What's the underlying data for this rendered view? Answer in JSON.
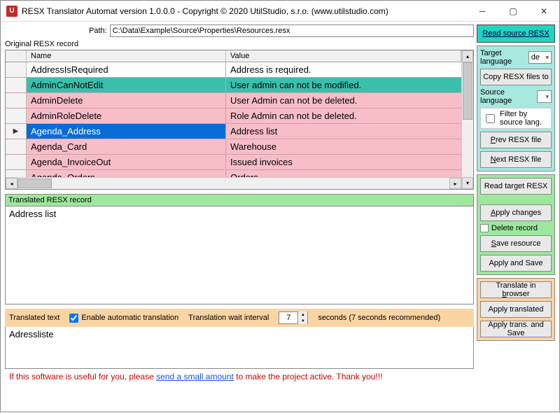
{
  "window": {
    "title": "RESX Translator Automat version 1.0.0.0 - Copyright © 2020 UtilStudio, s.r.o. (www.utilstudio.com)",
    "icon_letter": "U"
  },
  "path": {
    "label": "Path:",
    "value": "C:\\Data\\Example\\Source\\Properties\\Resources.resx"
  },
  "original": {
    "label": "Original RESX record",
    "col_name": "Name",
    "col_value": "Value",
    "rows": [
      {
        "name": "AddressIsRequired",
        "value": "Address is required.",
        "style": "white",
        "selected": false,
        "indicator": ""
      },
      {
        "name": "AdminCanNotEdit",
        "value": "User admin can not be modified.",
        "style": "teal",
        "selected": false,
        "indicator": ""
      },
      {
        "name": "AdminDelete",
        "value": "User Admin can not be deleted.",
        "style": "pink",
        "selected": false,
        "indicator": ""
      },
      {
        "name": "AdminRoleDelete",
        "value": "Role Admin can not be deleted.",
        "style": "pink",
        "selected": false,
        "indicator": ""
      },
      {
        "name": "Agenda_Address",
        "value": "Address list",
        "style": "pink",
        "selected": true,
        "indicator": "▶"
      },
      {
        "name": "Agenda_Card",
        "value": "Warehouse",
        "style": "pink",
        "selected": false,
        "indicator": ""
      },
      {
        "name": "Agenda_InvoiceOut",
        "value": "Issued invoices",
        "style": "pink",
        "selected": false,
        "indicator": ""
      },
      {
        "name": "Agenda_Orders",
        "value": "Orders",
        "style": "pink",
        "selected": false,
        "indicator": ""
      }
    ]
  },
  "translated_record": {
    "label": "Translated RESX record",
    "value": "Address list"
  },
  "translate_bar": {
    "label_left": "Translated text",
    "enable_label": "Enable automatic translation",
    "enable_checked": true,
    "interval_label": "Translation wait interval",
    "interval_value": "7",
    "interval_hint": "seconds (7 seconds recommended)"
  },
  "translated_text": {
    "value": "Adressliste"
  },
  "footer": {
    "prefix": "If this software is useful for you, please ",
    "link": "send a small amount",
    "suffix": " to make the project active. Thank you!!!"
  },
  "sidebar": {
    "read_source": "Read source RESX",
    "target_lang_label": "Target language",
    "target_lang_value": "de",
    "copy_files": "Copy RESX files to",
    "source_lang_label": "Source language",
    "source_lang_value": "",
    "filter_label": "Filter by source lang.",
    "filter_checked": false,
    "prev_file": "Prev RESX file",
    "next_file": "Next RESX file",
    "read_target": "Read target RESX",
    "apply_changes": "Apply changes",
    "delete_record": "Delete record",
    "delete_checked": false,
    "save_resource": "Save resource",
    "apply_and_save": "Apply and Save",
    "translate_browser": "Translate in browser",
    "apply_translated": "Apply translated",
    "apply_trans_save": "Apply trans. and Save"
  }
}
